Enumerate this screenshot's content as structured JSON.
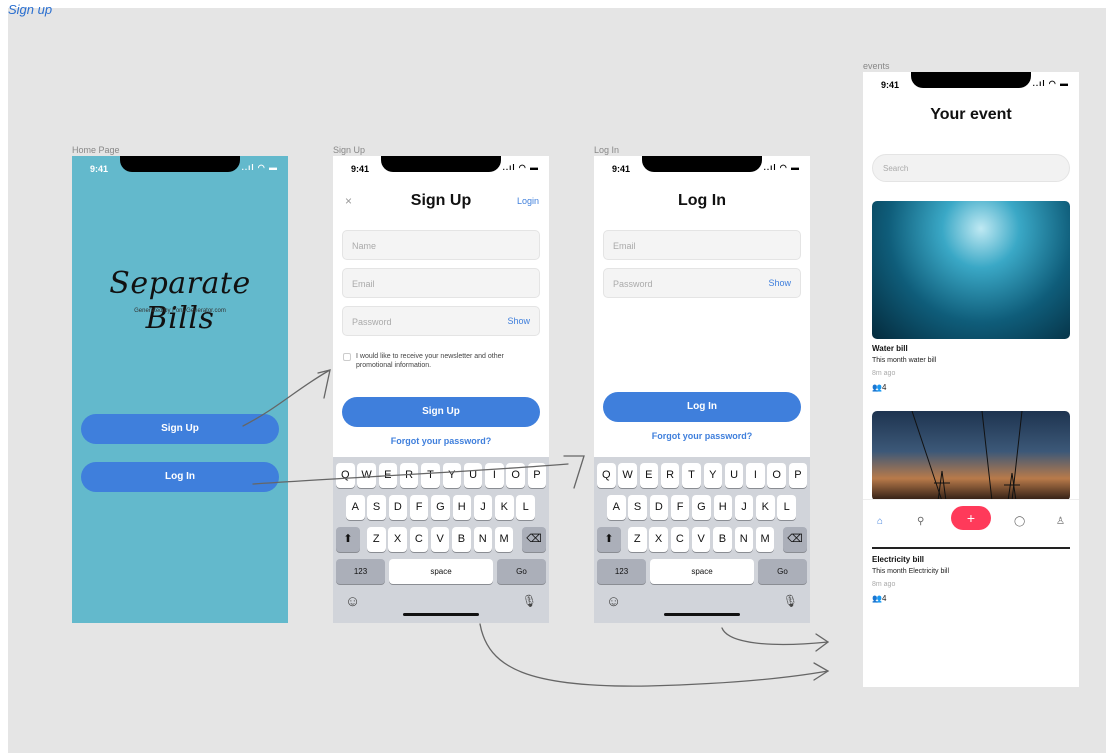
{
  "page_header": "Sign up",
  "frames": {
    "home": "Home Page",
    "signup": "Sign Up",
    "login": "Log In",
    "events": "events"
  },
  "status_time": "9:41",
  "status_icons": "..ıl ◠ ▬",
  "home": {
    "logo": "Separate Bills",
    "logo_credit": "Generated by Font-Generator.com",
    "signup_btn": "Sign Up",
    "login_btn": "Log In"
  },
  "signup": {
    "close": "×",
    "title": "Sign Up",
    "login_link": "Login",
    "name_placeholder": "Name",
    "email_placeholder": "Email",
    "password_placeholder": "Password",
    "show": "Show",
    "newsletter": "I would like to receive your newsletter and other promotional information.",
    "submit": "Sign Up",
    "forgot": "Forgot your password?"
  },
  "login": {
    "title": "Log In",
    "email_placeholder": "Email",
    "password_placeholder": "Password",
    "show": "Show",
    "submit": "Log In",
    "forgot": "Forgot your password?"
  },
  "keyboard": {
    "row1": [
      "Q",
      "W",
      "E",
      "R",
      "T",
      "Y",
      "U",
      "I",
      "O",
      "P"
    ],
    "row2": [
      "A",
      "S",
      "D",
      "F",
      "G",
      "H",
      "J",
      "K",
      "L"
    ],
    "row3": [
      "Z",
      "X",
      "C",
      "V",
      "B",
      "N",
      "M"
    ],
    "numbers": "123",
    "space": "space",
    "go": "Go",
    "shift": "⬆",
    "delete": "⌫",
    "emoji": "☺",
    "mic": "🎙"
  },
  "events": {
    "title": "Your event",
    "search_placeholder": "Search",
    "cards": [
      {
        "title": "Water bill",
        "desc": "This month water bill",
        "time": "8m ago",
        "people": "4"
      },
      {
        "title": "Electricity bill",
        "desc": "This month Electricity bill",
        "time": "8m ago",
        "people": "4"
      }
    ],
    "tabs": {
      "home": "⌂",
      "search": "⚲",
      "add": "+",
      "chat": "◯",
      "profile": "♙"
    }
  },
  "colors": {
    "canvas": "#e5e5e5",
    "home_bg": "#63b9cc",
    "accent": "#3f7fdc",
    "fab": "#ff3a5a"
  }
}
